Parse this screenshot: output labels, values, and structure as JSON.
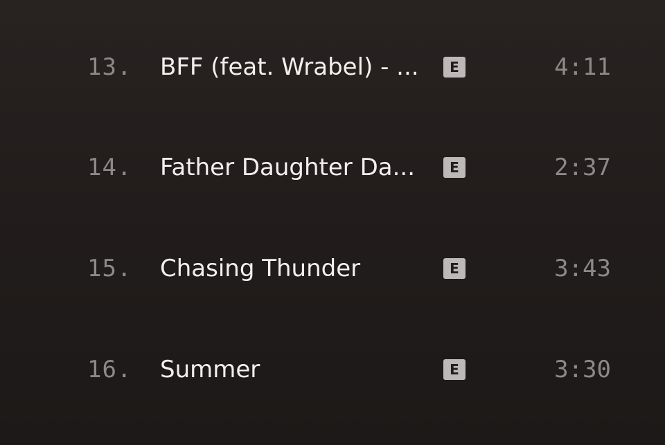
{
  "tracks": [
    {
      "number": "13.",
      "title": "BFF (feat. Wrabel) - ...",
      "explicit": "E",
      "duration": "4:11"
    },
    {
      "number": "14.",
      "title": "Father Daughter Da...",
      "explicit": "E",
      "duration": "2:37"
    },
    {
      "number": "15.",
      "title": "Chasing Thunder",
      "explicit": "E",
      "duration": "3:43"
    },
    {
      "number": "16.",
      "title": "Summer",
      "explicit": "E",
      "duration": "3:30"
    }
  ],
  "colors": {
    "background": "#241f1e",
    "title_text": "#f2efee",
    "muted_text": "#8d8988",
    "explicit_badge": "#bdb9b8"
  }
}
